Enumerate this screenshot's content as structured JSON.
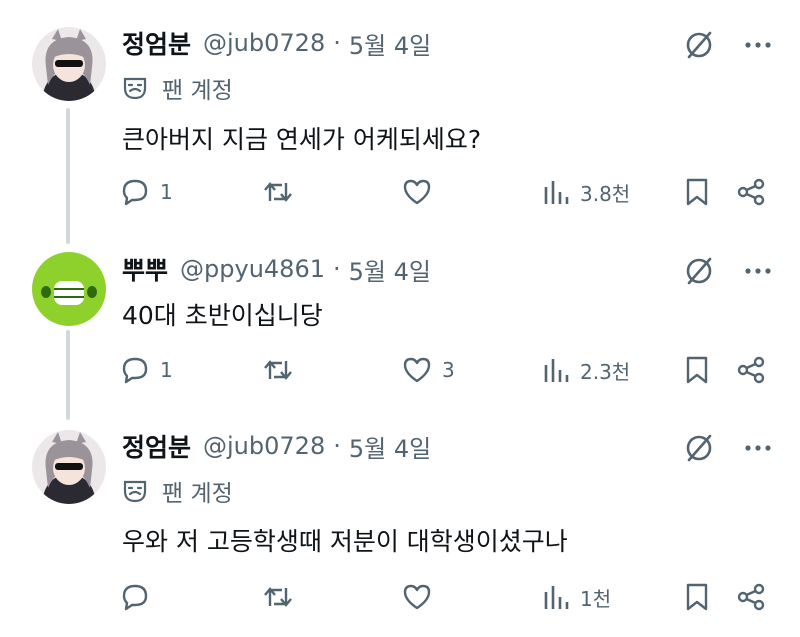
{
  "posts": [
    {
      "name": "정엄분",
      "handle": "@jub0728",
      "dot": "·",
      "date": "5월 4일",
      "badge": "팬 계정",
      "text": "큰아버지 지금 연세가 어케되세요?",
      "reply_count": "1",
      "repost_count": "",
      "like_count": "",
      "view_count": "3.8천"
    },
    {
      "name": "뿌뿌",
      "handle": "@ppyu4861",
      "dot": "·",
      "date": "5월 4일",
      "text": "40대 초반이십니당",
      "reply_count": "1",
      "repost_count": "",
      "like_count": "3",
      "view_count": "2.3천"
    },
    {
      "name": "정엄분",
      "handle": "@jub0728",
      "dot": "·",
      "date": "5월 4일",
      "badge": "팬 계정",
      "text": "우와 저 고등학생때 저분이 대학생이셨구나",
      "reply_count": "",
      "repost_count": "",
      "like_count": "",
      "view_count": "1천"
    }
  ],
  "icons": {
    "reply": "reply-icon",
    "repost": "repost-icon",
    "like": "like-icon",
    "views": "views-icon",
    "bookmark": "bookmark-icon",
    "share": "share-icon",
    "grok": "grok-icon",
    "more": "more-icon",
    "badge": "theater-mask-icon"
  },
  "colors": {
    "text": "#0f1419",
    "secondary": "#536471",
    "connector": "#cfd9de",
    "avatar2_bg": "#8fd12c"
  }
}
